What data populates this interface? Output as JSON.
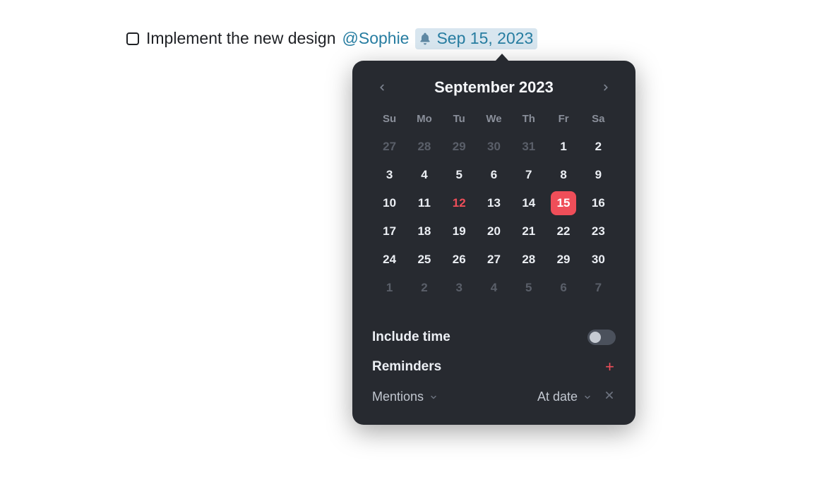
{
  "task": {
    "text": "Implement the new design",
    "mention": "@Sophie",
    "date_label": "Sep 15, 2023"
  },
  "calendar": {
    "month_title": "September 2023",
    "weekdays": [
      "Su",
      "Mo",
      "Tu",
      "We",
      "Th",
      "Fr",
      "Sa"
    ],
    "cells": [
      {
        "d": "27",
        "out": true
      },
      {
        "d": "28",
        "out": true
      },
      {
        "d": "29",
        "out": true
      },
      {
        "d": "30",
        "out": true
      },
      {
        "d": "31",
        "out": true
      },
      {
        "d": "1"
      },
      {
        "d": "2"
      },
      {
        "d": "3"
      },
      {
        "d": "4"
      },
      {
        "d": "5"
      },
      {
        "d": "6"
      },
      {
        "d": "7"
      },
      {
        "d": "8"
      },
      {
        "d": "9"
      },
      {
        "d": "10"
      },
      {
        "d": "11"
      },
      {
        "d": "12",
        "today": true
      },
      {
        "d": "13"
      },
      {
        "d": "14"
      },
      {
        "d": "15",
        "selected": true
      },
      {
        "d": "16"
      },
      {
        "d": "17"
      },
      {
        "d": "18"
      },
      {
        "d": "19"
      },
      {
        "d": "20"
      },
      {
        "d": "21"
      },
      {
        "d": "22"
      },
      {
        "d": "23"
      },
      {
        "d": "24"
      },
      {
        "d": "25"
      },
      {
        "d": "26"
      },
      {
        "d": "27"
      },
      {
        "d": "28"
      },
      {
        "d": "29"
      },
      {
        "d": "30"
      },
      {
        "d": "1",
        "out": true
      },
      {
        "d": "2",
        "out": true
      },
      {
        "d": "3",
        "out": true
      },
      {
        "d": "4",
        "out": true
      },
      {
        "d": "5",
        "out": true
      },
      {
        "d": "6",
        "out": true
      },
      {
        "d": "7",
        "out": true
      }
    ]
  },
  "options": {
    "include_time_label": "Include time",
    "reminders_label": "Reminders",
    "reminder_type": "Mentions",
    "reminder_timing": "At date"
  }
}
